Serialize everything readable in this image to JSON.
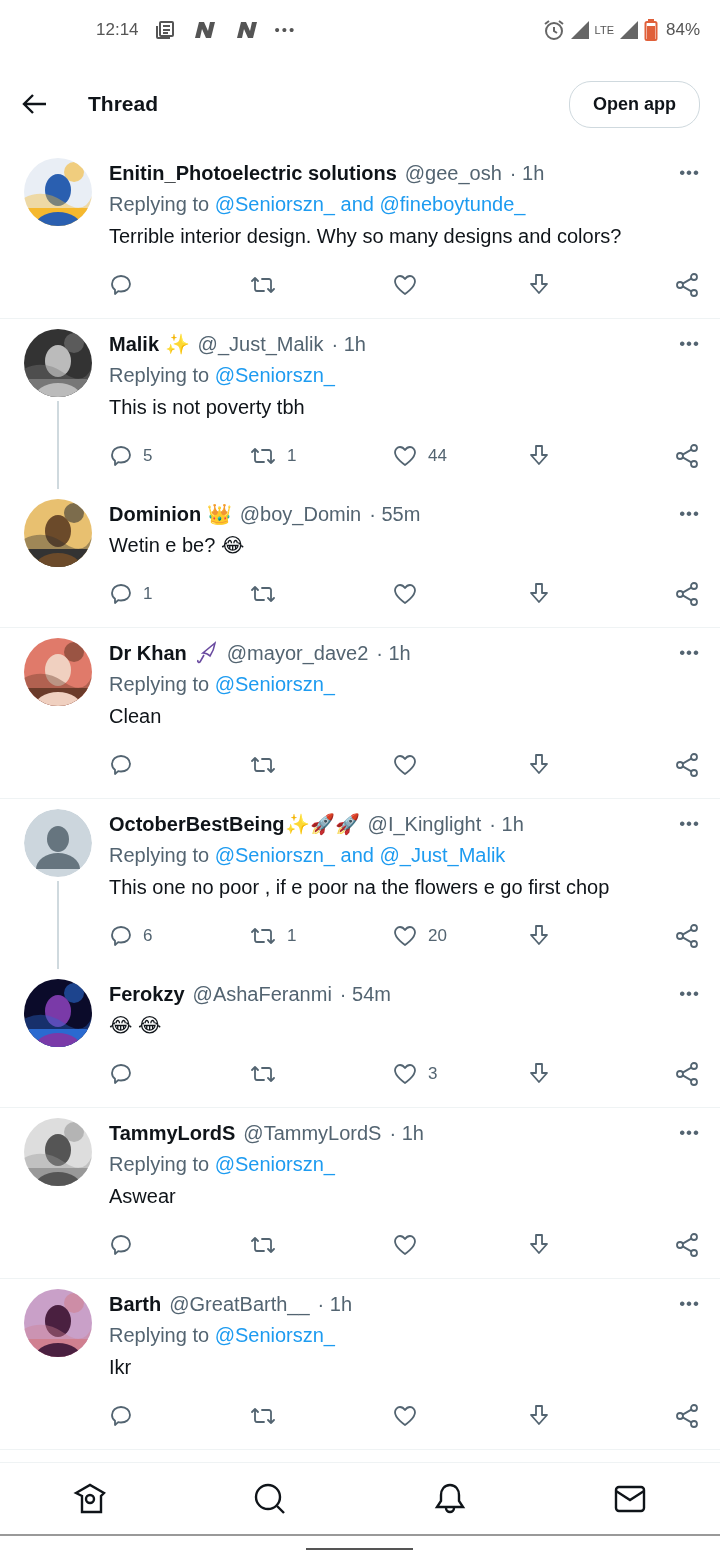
{
  "status_bar": {
    "time": "12:14",
    "more": "•••",
    "network": "LTE",
    "battery": "84%"
  },
  "header": {
    "title": "Thread",
    "button": "Open app"
  },
  "tweets": [
    {
      "name": "Enitin_Photoelectric solutions",
      "badge": false,
      "handle": "@gee_osh",
      "time": "· 1h",
      "menu": "•••",
      "replying_label": "Replying to",
      "replying_to": "@Seniorszn_ and @fineboytunde_",
      "text": "Terrible interior design. Why so many designs and colors?",
      "thread_next": false
    },
    {
      "name": "Malik ✨",
      "badge": false,
      "handle": "@_Just_Malik",
      "time": "· 1h",
      "menu": "•••",
      "replying_label": "Replying to",
      "replying_to": "@Seniorszn_",
      "text": "This is not poverty tbh",
      "replies": "5",
      "retweets": "1",
      "likes": "44",
      "thread_next": true
    },
    {
      "name": "Dominion 👑",
      "badge": false,
      "handle": "@boy_Domin",
      "time": "· 55m",
      "menu": "•••",
      "text": "Wetin e be? 😂",
      "replies": "1",
      "thread_next": false
    },
    {
      "name": "Dr Khan",
      "badge": true,
      "handle": "@mayor_dave2",
      "time": "· 1h",
      "menu": "•••",
      "replying_label": "Replying to",
      "replying_to": "@Seniorszn_",
      "text": "Clean",
      "thread_next": false
    },
    {
      "avatar": {
        "kind": "default"
      },
      "name": "OctoberBestBeing✨🚀🚀",
      "badge": false,
      "handle": "@I_Kinglight",
      "time": "· 1h",
      "menu": "•••",
      "replying_label": "Replying to",
      "replying_to": "@Seniorszn_ and @_Just_Malik",
      "text": "This one no poor , if e poor na the flowers e go first chop",
      "replies": "6",
      "retweets": "1",
      "likes": "20",
      "thread_next": true
    },
    {
      "name": "Ferokzy",
      "badge": false,
      "handle": "@AshaFeranmi",
      "time": "· 54m",
      "menu": "•••",
      "text": "😂 😂",
      "likes": "3",
      "thread_next": false
    },
    {
      "name": "TammyLordS",
      "badge": false,
      "handle": "@TammyLordS",
      "time": "· 1h",
      "menu": "•••",
      "replying_label": "Replying to",
      "replying_to": "@Seniorszn_",
      "text": "Aswear",
      "thread_next": false
    },
    {
      "name": "Barth",
      "badge": false,
      "handle": "@GreatBarth__",
      "time": "· 1h",
      "menu": "•••",
      "replying_label": "Replying to",
      "replying_to": "@Seniorszn_",
      "text": "Ikr",
      "thread_next": false
    }
  ]
}
